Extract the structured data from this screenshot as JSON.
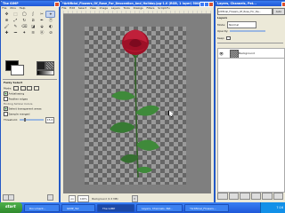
{
  "toolbox": {
    "title": "The GIMP",
    "menu": [
      "File",
      "Xtns",
      "Help"
    ],
    "tools": [
      "✥",
      "⬚",
      "◯",
      "ʃ",
      "✂",
      "⌖",
      "⊕",
      "⤢",
      "↻",
      "⧄",
      "✒",
      "Ⓣ",
      "🖌",
      "✎",
      "⌫",
      "◪",
      "⬙",
      "◐",
      "✚",
      "⎓",
      "✦",
      "≋",
      "Ⓐ",
      "⊘"
    ],
    "options_title": "Fuzzy Select",
    "mode_label": "Mode:",
    "antialiasing": "Antialiasing",
    "feather_edges": "Feather edges",
    "finding_similar": "Finding Similar Colors",
    "select_transparent": "Select transparent areas",
    "sample_merged": "Sample merged",
    "threshold_label": "Threshold:",
    "threshold_value": "15.0"
  },
  "image_window": {
    "title": "*Artificial_Flowers_Of_Rose_For_Decoration_And_Holiday.jpg-1.0 (RGB, 1 layer) 500x...",
    "menu": [
      "File",
      "Edit",
      "Select",
      "View",
      "Image",
      "Layers",
      "Tools",
      "Dialogs",
      "Filters",
      "Script-Fu"
    ],
    "status_unit": "px",
    "status_zoom": "100%",
    "status_text": "Background (1.5 MB)"
  },
  "layers_window": {
    "title": "Layers, Channels, Pat...",
    "image_selector": "Artificial_Flowers_Of_Rose_For_De...",
    "auto_label": "Auto",
    "section": "Layers",
    "mode_label": "Mode:",
    "mode_value": "Normal",
    "opacity_label": "Opacity:",
    "keep_label": "Keep:",
    "layer_name": "Background"
  },
  "taskbar": {
    "start_label": "start",
    "items": [
      "Document...",
      "GIMP_Tut",
      "The GIMP",
      "Layers, Channels, Pat...",
      "*Artificial_Flowers..."
    ],
    "active_index": 2,
    "clock": "7:16"
  },
  "colors": {
    "accent": "#2459c6",
    "rose": "#b0162e",
    "leaf": "#3f8a3a"
  }
}
